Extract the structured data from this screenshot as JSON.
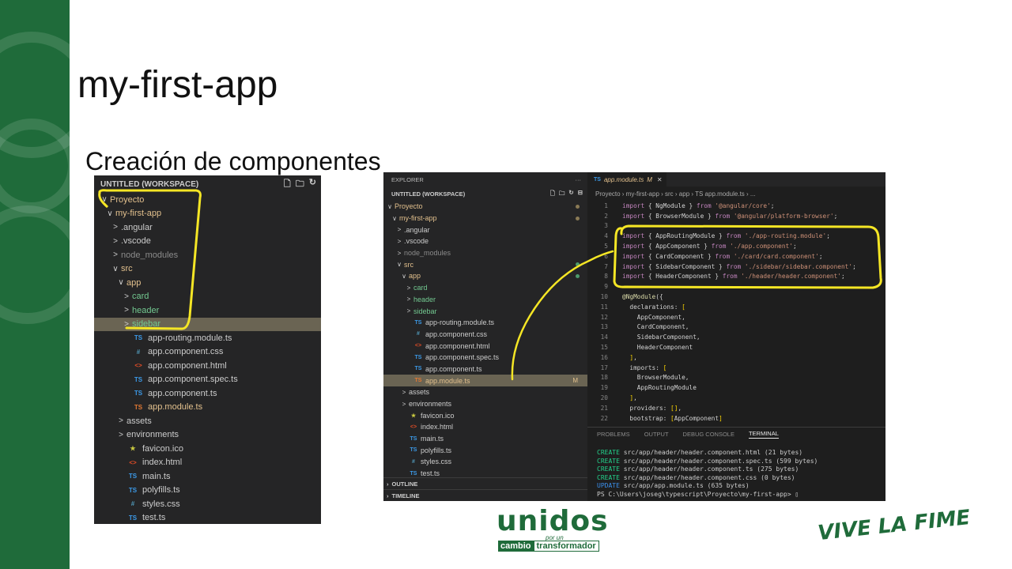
{
  "slide": {
    "title": "my-first-app",
    "subtitle": "Creación de componentes"
  },
  "explorer_left": {
    "header": "UNTITLED (WORKSPACE)",
    "items": [
      {
        "label": "Proyecto",
        "arrow": "∨",
        "color": "yellow",
        "icon": ""
      },
      {
        "label": "my-first-app",
        "arrow": "∨",
        "color": "yellow",
        "icon": ""
      },
      {
        "label": ".angular",
        "arrow": ">",
        "color": "white",
        "icon": ""
      },
      {
        "label": ".vscode",
        "arrow": ">",
        "color": "white",
        "icon": ""
      },
      {
        "label": "node_modules",
        "arrow": ">",
        "color": "grey",
        "icon": ""
      },
      {
        "label": "src",
        "arrow": "∨",
        "color": "yellow",
        "icon": ""
      },
      {
        "label": "app",
        "arrow": "∨",
        "color": "yellow",
        "icon": ""
      },
      {
        "label": "card",
        "arrow": ">",
        "color": "green",
        "icon": ""
      },
      {
        "label": "header",
        "arrow": ">",
        "color": "green",
        "icon": ""
      },
      {
        "label": "sidebar",
        "arrow": ">",
        "color": "green",
        "icon": ""
      },
      {
        "label": "app-routing.module.ts",
        "arrow": "",
        "color": "white",
        "icon": "TS"
      },
      {
        "label": "app.component.css",
        "arrow": "",
        "color": "white",
        "icon": "#"
      },
      {
        "label": "app.component.html",
        "arrow": "",
        "color": "white",
        "icon": "<>"
      },
      {
        "label": "app.component.spec.ts",
        "arrow": "",
        "color": "white",
        "icon": "TS"
      },
      {
        "label": "app.component.ts",
        "arrow": "",
        "color": "white",
        "icon": "TS"
      },
      {
        "label": "app.module.ts",
        "arrow": "",
        "color": "yellow",
        "icon": "TS"
      },
      {
        "label": "assets",
        "arrow": ">",
        "color": "white",
        "icon": ""
      },
      {
        "label": "environments",
        "arrow": ">",
        "color": "white",
        "icon": ""
      },
      {
        "label": "favicon.ico",
        "arrow": "",
        "color": "white",
        "icon": "★"
      },
      {
        "label": "index.html",
        "arrow": "",
        "color": "white",
        "icon": "<>"
      },
      {
        "label": "main.ts",
        "arrow": "",
        "color": "white",
        "icon": "TS"
      },
      {
        "label": "polyfills.ts",
        "arrow": "",
        "color": "white",
        "icon": "TS"
      },
      {
        "label": "styles.css",
        "arrow": "",
        "color": "white",
        "icon": "#"
      },
      {
        "label": "test.ts",
        "arrow": "",
        "color": "white",
        "icon": "TS"
      }
    ]
  },
  "vscode": {
    "explorer_title": "EXPLORER",
    "workspace": "UNTITLED (WORKSPACE)",
    "items": [
      {
        "label": "Proyecto",
        "arrow": "∨",
        "color": "yellow",
        "icon": ""
      },
      {
        "label": "my-first-app",
        "arrow": "∨",
        "color": "yellow",
        "icon": ""
      },
      {
        "label": ".angular",
        "arrow": ">",
        "color": "white",
        "icon": ""
      },
      {
        "label": ".vscode",
        "arrow": ">",
        "color": "white",
        "icon": ""
      },
      {
        "label": "node_modules",
        "arrow": ">",
        "color": "grey",
        "icon": ""
      },
      {
        "label": "src",
        "arrow": "∨",
        "color": "yellow",
        "icon": ""
      },
      {
        "label": "app",
        "arrow": "∨",
        "color": "yellow",
        "icon": ""
      },
      {
        "label": "card",
        "arrow": ">",
        "color": "green",
        "icon": ""
      },
      {
        "label": "header",
        "arrow": ">",
        "color": "green",
        "icon": ""
      },
      {
        "label": "sidebar",
        "arrow": ">",
        "color": "green",
        "icon": ""
      },
      {
        "label": "app-routing.module.ts",
        "arrow": "",
        "color": "white",
        "icon": "TS"
      },
      {
        "label": "app.component.css",
        "arrow": "",
        "color": "white",
        "icon": "#"
      },
      {
        "label": "app.component.html",
        "arrow": "",
        "color": "white",
        "icon": "<>"
      },
      {
        "label": "app.component.spec.ts",
        "arrow": "",
        "color": "white",
        "icon": "TS"
      },
      {
        "label": "app.component.ts",
        "arrow": "",
        "color": "white",
        "icon": "TS"
      },
      {
        "label": "app.module.ts",
        "arrow": "",
        "color": "yellow",
        "icon": "TS",
        "badge": "M"
      },
      {
        "label": "assets",
        "arrow": ">",
        "color": "white",
        "icon": ""
      },
      {
        "label": "environments",
        "arrow": ">",
        "color": "white",
        "icon": ""
      },
      {
        "label": "favicon.ico",
        "arrow": "",
        "color": "white",
        "icon": "★"
      },
      {
        "label": "index.html",
        "arrow": "",
        "color": "white",
        "icon": "<>"
      },
      {
        "label": "main.ts",
        "arrow": "",
        "color": "white",
        "icon": "TS"
      },
      {
        "label": "polyfills.ts",
        "arrow": "",
        "color": "white",
        "icon": "TS"
      },
      {
        "label": "styles.css",
        "arrow": "",
        "color": "white",
        "icon": "#"
      },
      {
        "label": "test.ts",
        "arrow": "",
        "color": "white",
        "icon": "TS"
      }
    ],
    "outline_label": "OUTLINE",
    "timeline_label": "TIMELINE",
    "tab": {
      "icon": "TS",
      "label": "app.module.ts",
      "status": "M"
    },
    "breadcrumb": "Proyecto › my-first-app › src › app › TS app.module.ts › ...",
    "code_lines": [
      [
        [
          "kw",
          "import"
        ],
        [
          "id",
          " { NgModule } "
        ],
        [
          "kw",
          "from"
        ],
        [
          "str",
          " '@angular/core'"
        ],
        [
          "id",
          ";"
        ]
      ],
      [
        [
          "kw",
          "import"
        ],
        [
          "id",
          " { BrowserModule } "
        ],
        [
          "kw",
          "from"
        ],
        [
          "str",
          " '@angular/platform-browser'"
        ],
        [
          "id",
          ";"
        ]
      ],
      [],
      [
        [
          "kw",
          "import"
        ],
        [
          "id",
          " { AppRoutingModule } "
        ],
        [
          "kw",
          "from"
        ],
        [
          "str",
          " './app-routing.module'"
        ],
        [
          "id",
          ";"
        ]
      ],
      [
        [
          "kw",
          "import"
        ],
        [
          "id",
          " { AppComponent } "
        ],
        [
          "kw",
          "from"
        ],
        [
          "str",
          " './app.component'"
        ],
        [
          "id",
          ";"
        ]
      ],
      [
        [
          "kw",
          "import"
        ],
        [
          "id",
          " { CardComponent } "
        ],
        [
          "kw",
          "from"
        ],
        [
          "str",
          " './card/card.component'"
        ],
        [
          "id",
          ";"
        ]
      ],
      [
        [
          "kw",
          "import"
        ],
        [
          "id",
          " { SidebarComponent } "
        ],
        [
          "kw",
          "from"
        ],
        [
          "str",
          " './sidebar/sidebar.component'"
        ],
        [
          "id",
          ";"
        ]
      ],
      [
        [
          "kw",
          "import"
        ],
        [
          "id",
          " { HeaderComponent } "
        ],
        [
          "kw",
          "from"
        ],
        [
          "str",
          " './header/header.component'"
        ],
        [
          "id",
          ";"
        ]
      ],
      [],
      [
        [
          "dec",
          "@NgModule"
        ],
        [
          "id",
          "({"
        ]
      ],
      [
        [
          "id",
          "  declarations: "
        ],
        [
          "br",
          "["
        ]
      ],
      [
        [
          "id",
          "    AppComponent,"
        ]
      ],
      [
        [
          "id",
          "    CardComponent,"
        ]
      ],
      [
        [
          "id",
          "    SidebarComponent,"
        ]
      ],
      [
        [
          "id",
          "    HeaderComponent"
        ]
      ],
      [
        [
          "id",
          "  "
        ],
        [
          "br",
          "]"
        ],
        [
          "id",
          ","
        ]
      ],
      [
        [
          "id",
          "  imports: "
        ],
        [
          "br",
          "["
        ]
      ],
      [
        [
          "id",
          "    BrowserModule,"
        ]
      ],
      [
        [
          "id",
          "    AppRoutingModule"
        ]
      ],
      [
        [
          "id",
          "  "
        ],
        [
          "br",
          "]"
        ],
        [
          "id",
          ","
        ]
      ],
      [
        [
          "id",
          "  providers: "
        ],
        [
          "br",
          "[]"
        ],
        [
          "id",
          ","
        ]
      ],
      [
        [
          "id",
          "  bootstrap: "
        ],
        [
          "br",
          "["
        ],
        [
          "id",
          "AppComponent"
        ],
        [
          "br",
          "]"
        ]
      ]
    ],
    "terminal_tabs": [
      "PROBLEMS",
      "OUTPUT",
      "DEBUG CONSOLE",
      "TERMINAL"
    ],
    "terminal_active": 3,
    "terminal_lines": [
      [
        [
          "t-green",
          "CREATE"
        ],
        [
          "plain",
          " src/app/header/header.component.html (21 bytes)"
        ]
      ],
      [
        [
          "t-green",
          "CREATE"
        ],
        [
          "plain",
          " src/app/header/header.component.spec.ts (599 bytes)"
        ]
      ],
      [
        [
          "t-green",
          "CREATE"
        ],
        [
          "plain",
          " src/app/header/header.component.ts (275 bytes)"
        ]
      ],
      [
        [
          "t-green",
          "CREATE"
        ],
        [
          "plain",
          " src/app/header/header.component.css (0 bytes)"
        ]
      ],
      [
        [
          "t-blue",
          "UPDATE"
        ],
        [
          "plain",
          " src/app/app.module.ts (635 bytes)"
        ]
      ],
      [
        [
          "plain",
          "PS C:\\Users\\joseg\\typescript\\Proyecto\\my-first-app> ▯"
        ]
      ]
    ]
  },
  "logos": {
    "unidos": "unidos",
    "unidos_small": "por un",
    "unidos_bar_1": "cambio",
    "unidos_bar_2": "transformador",
    "vive": "VIVE LA FIME"
  },
  "colors": {
    "brand_green": "#1f6b3a",
    "annotation_yellow": "#f5e625"
  }
}
